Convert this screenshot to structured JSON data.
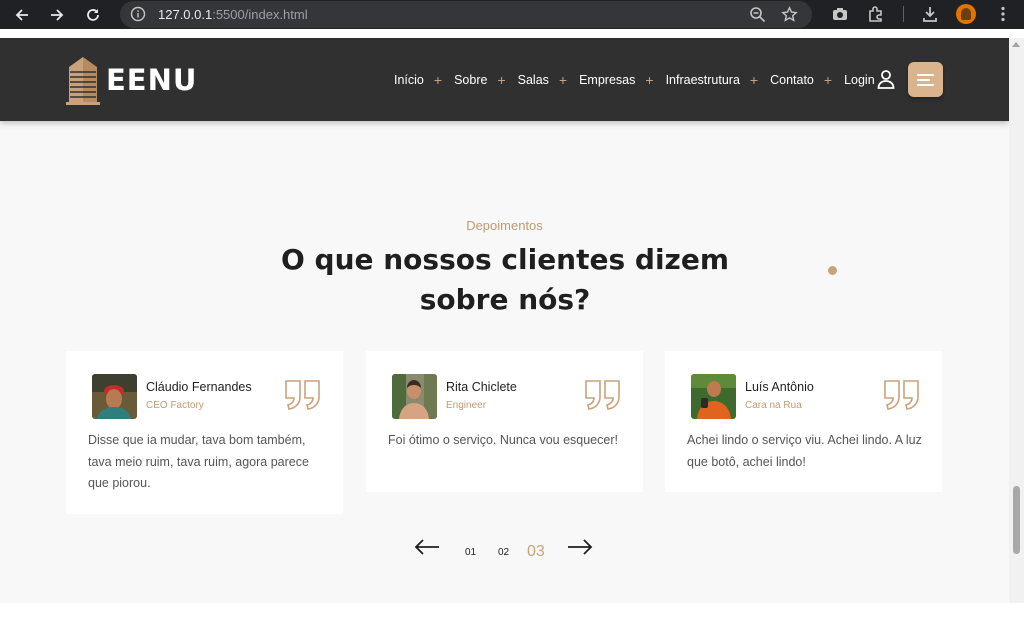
{
  "browser": {
    "url_host": "127.0.0.1",
    "url_rest": ":5500/index.html"
  },
  "header": {
    "logo_text": "EENU",
    "menu": [
      {
        "label": "Início"
      },
      {
        "label": "Sobre"
      },
      {
        "label": "Salas"
      },
      {
        "label": "Empresas"
      },
      {
        "label": "Infraestrutura"
      },
      {
        "label": "Contato"
      },
      {
        "label": "Login"
      }
    ]
  },
  "section": {
    "eyebrow": "Depoimentos",
    "title_line1": "O que nossos clientes dizem",
    "title_line2": "sobre nós?"
  },
  "testimonials": [
    {
      "name": "Cláudio Fernandes",
      "role": "CEO Factory",
      "text": "Disse que ia mudar, tava bom também, tava meio ruim, tava ruim, agora parece que piorou."
    },
    {
      "name": "Rita Chiclete",
      "role": "Engineer",
      "text": "Foi ótimo o serviço. Nunca vou esquecer!"
    },
    {
      "name": "Luís Antônio",
      "role": "Cara na Rua",
      "text": "Achei lindo o serviço viu. Achei lindo. A luz que botô, achei lindo!"
    }
  ],
  "pagination": {
    "pages": [
      "01",
      "02",
      "03"
    ],
    "current": "03"
  },
  "colors": {
    "accent": "#c9a27c",
    "header_bg": "#303030",
    "section_bg": "#f8f8f8"
  }
}
